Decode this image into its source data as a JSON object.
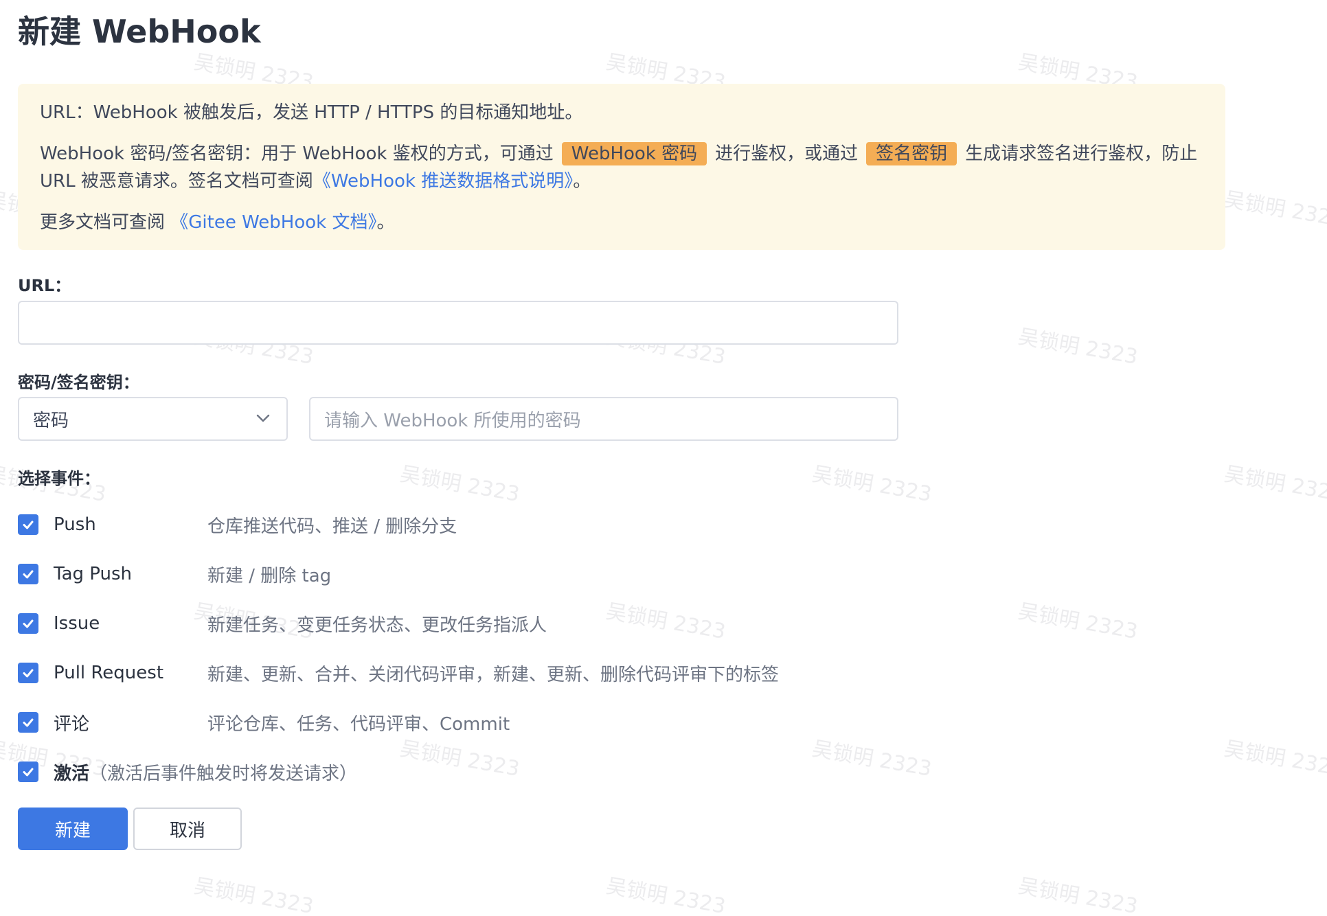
{
  "page_title": "新建 WebHook",
  "watermark_text": "吴锁明 2323",
  "notice": {
    "line1": "URL：WebHook 被触发后，发送 HTTP / HTTPS 的目标通知地址。",
    "line2_a": "WebHook 密码/签名密钥：用于 WebHook 鉴权的方式，可通过",
    "tag_password": "WebHook 密码",
    "line2_b": "进行鉴权，或通过",
    "tag_sign": "签名密钥",
    "line2_c": "生成请求签名进行鉴权，防止 URL 被恶意请求。签名文档可查阅",
    "link_format": "《WebHook 推送数据格式说明》",
    "line2_end": "。",
    "line3_a": "更多文档可查阅",
    "link_docs": "《Gitee WebHook 文档》",
    "line3_end": "。"
  },
  "url_field": {
    "label": "URL：",
    "value": ""
  },
  "secret_field": {
    "label": "密码/签名密钥：",
    "select_value": "密码",
    "placeholder": "请输入 WebHook 所使用的密码"
  },
  "events_label": "选择事件：",
  "events": [
    {
      "name": "Push",
      "desc": "仓库推送代码、推送 / 删除分支",
      "checked": true
    },
    {
      "name": "Tag Push",
      "desc": "新建 / 删除 tag",
      "checked": true
    },
    {
      "name": "Issue",
      "desc": "新建任务、变更任务状态、更改任务指派人",
      "checked": true
    },
    {
      "name": "Pull Request",
      "desc": "新建、更新、合并、关闭代码评审，新建、更新、删除代码评审下的标签",
      "checked": true
    },
    {
      "name": "评论",
      "desc": "评论仓库、任务、代码评审、Commit",
      "checked": true
    }
  ],
  "active": {
    "label": "激活",
    "note": "（激活后事件触发时将发送请求）",
    "checked": true
  },
  "buttons": {
    "create": "新建",
    "cancel": "取消"
  },
  "colors": {
    "primary": "#3d78e3",
    "notice_bg": "#fdf8e6",
    "tag_bg": "#f4ad55"
  }
}
